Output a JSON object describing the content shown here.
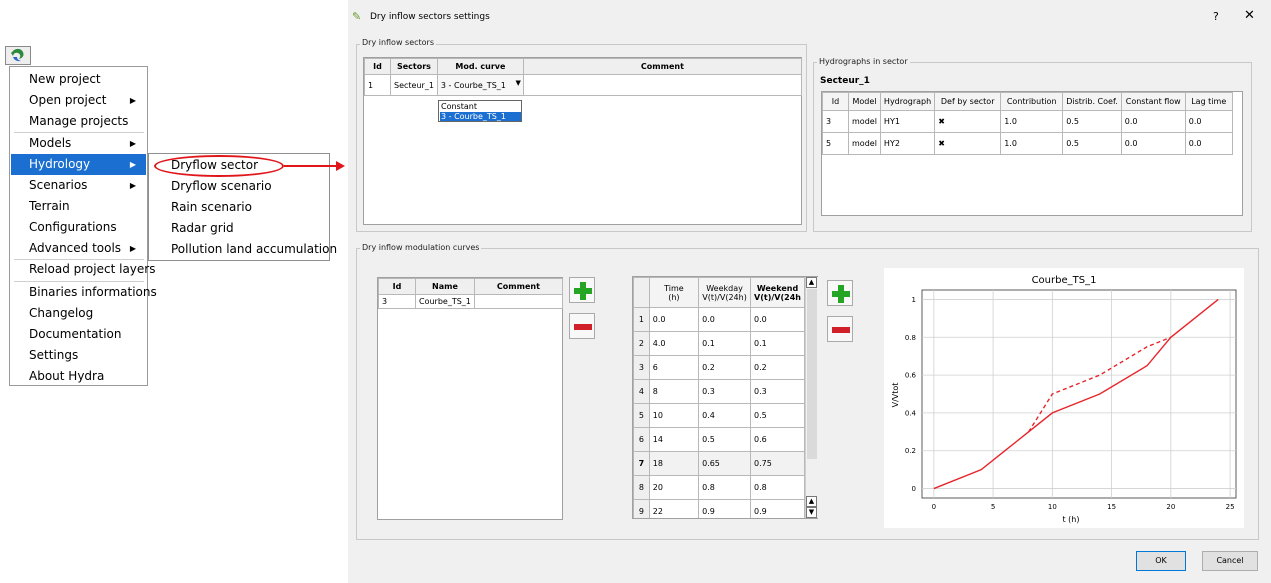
{
  "menu": {
    "items": [
      {
        "label": "New project",
        "arrow": false
      },
      {
        "label": "Open project",
        "arrow": true
      },
      {
        "label": "Manage projects",
        "arrow": false
      },
      {
        "label": "Models",
        "arrow": true
      },
      {
        "label": "Hydrology",
        "arrow": true
      },
      {
        "label": "Scenarios",
        "arrow": true
      },
      {
        "label": "Terrain",
        "arrow": false
      },
      {
        "label": "Configurations",
        "arrow": false
      },
      {
        "label": "Advanced tools",
        "arrow": true
      },
      {
        "label": "Reload project layers",
        "arrow": false
      },
      {
        "label": "Binaries informations",
        "arrow": false
      },
      {
        "label": "Changelog",
        "arrow": false
      },
      {
        "label": "Documentation",
        "arrow": false
      },
      {
        "label": "Settings",
        "arrow": false
      },
      {
        "label": "About Hydra",
        "arrow": false
      }
    ],
    "arrow_glyph": "▶",
    "highlight_color": "#1a6fd0"
  },
  "submenu": {
    "items": [
      "Dryflow sector",
      "Dryflow scenario",
      "Rain scenario",
      "Radar grid",
      "Pollution land accumulation"
    ]
  },
  "dialog": {
    "title": "Dry inflow sectors settings",
    "help": "?",
    "close": "✕",
    "sectors_group": "Dry inflow sectors",
    "sectors_table": {
      "headers": [
        "Id",
        "Sectors",
        "Mod. curve",
        "Comment"
      ],
      "rows": [
        [
          "1",
          "Secteur_1",
          "3 - Courbe_TS_1",
          ""
        ]
      ]
    },
    "dropdown_options": [
      "Constant",
      "3 - Courbe_TS_1"
    ],
    "hydrographs_group": "Hydrographs in sector",
    "sector_name": "Secteur_1",
    "hydrographs_table": {
      "headers": [
        "Id",
        "Model",
        "Hydrograph",
        "Def by sector",
        "Contribution",
        "Distrib. Coef.",
        "Constant flow",
        "Lag time"
      ],
      "rows": [
        [
          "3",
          "model",
          "HY1",
          "✖",
          "1.0",
          "0.5",
          "0.0",
          "0.0"
        ],
        [
          "5",
          "model",
          "HY2",
          "✖",
          "1.0",
          "0.5",
          "0.0",
          "0.0"
        ]
      ]
    },
    "curves_group": "Dry inflow modulation curves",
    "curves_table": {
      "headers": [
        "Id",
        "Name",
        "Comment"
      ],
      "rows": [
        [
          "3",
          "Courbe_TS_1",
          ""
        ]
      ]
    },
    "time_table": {
      "headers": [
        [
          "Time",
          "(h)"
        ],
        [
          "Weekday",
          "V(t)/V(24h)"
        ],
        [
          "Weekend",
          "V(t)/V(24h"
        ]
      ],
      "rows": [
        [
          "1",
          "0.0",
          "0.0",
          "0.0"
        ],
        [
          "2",
          "4.0",
          "0.1",
          "0.1"
        ],
        [
          "3",
          "6",
          "0.2",
          "0.2"
        ],
        [
          "4",
          "8",
          "0.3",
          "0.3"
        ],
        [
          "5",
          "10",
          "0.4",
          "0.5"
        ],
        [
          "6",
          "14",
          "0.5",
          "0.6"
        ],
        [
          "7",
          "18",
          "0.65",
          "0.75"
        ],
        [
          "8",
          "20",
          "0.8",
          "0.8"
        ],
        [
          "9",
          "22",
          "0.9",
          "0.9"
        ]
      ]
    },
    "ok_label": "OK",
    "cancel_label": "Cancel"
  },
  "chart_data": {
    "type": "line",
    "title": "Courbe_TS_1",
    "xlabel": "t (h)",
    "ylabel": "V/Vtot",
    "xlim": [
      -1,
      25.5
    ],
    "ylim": [
      -0.05,
      1.05
    ],
    "xticks": [
      0,
      5,
      10,
      15,
      20,
      25
    ],
    "yticks": [
      0.0,
      0.2,
      0.4,
      0.6,
      0.8,
      1.0
    ],
    "grid": true,
    "series": [
      {
        "style": "solid",
        "color": "#e8252b",
        "x": [
          0,
          4,
          6,
          8,
          10,
          14,
          18,
          20,
          24
        ],
        "y": [
          0,
          0.1,
          0.2,
          0.3,
          0.4,
          0.5,
          0.65,
          0.8,
          1.0
        ]
      },
      {
        "style": "dashed",
        "color": "#e8252b",
        "x": [
          8,
          10,
          14,
          18,
          20
        ],
        "y": [
          0.3,
          0.5,
          0.6,
          0.75,
          0.8
        ]
      }
    ]
  }
}
